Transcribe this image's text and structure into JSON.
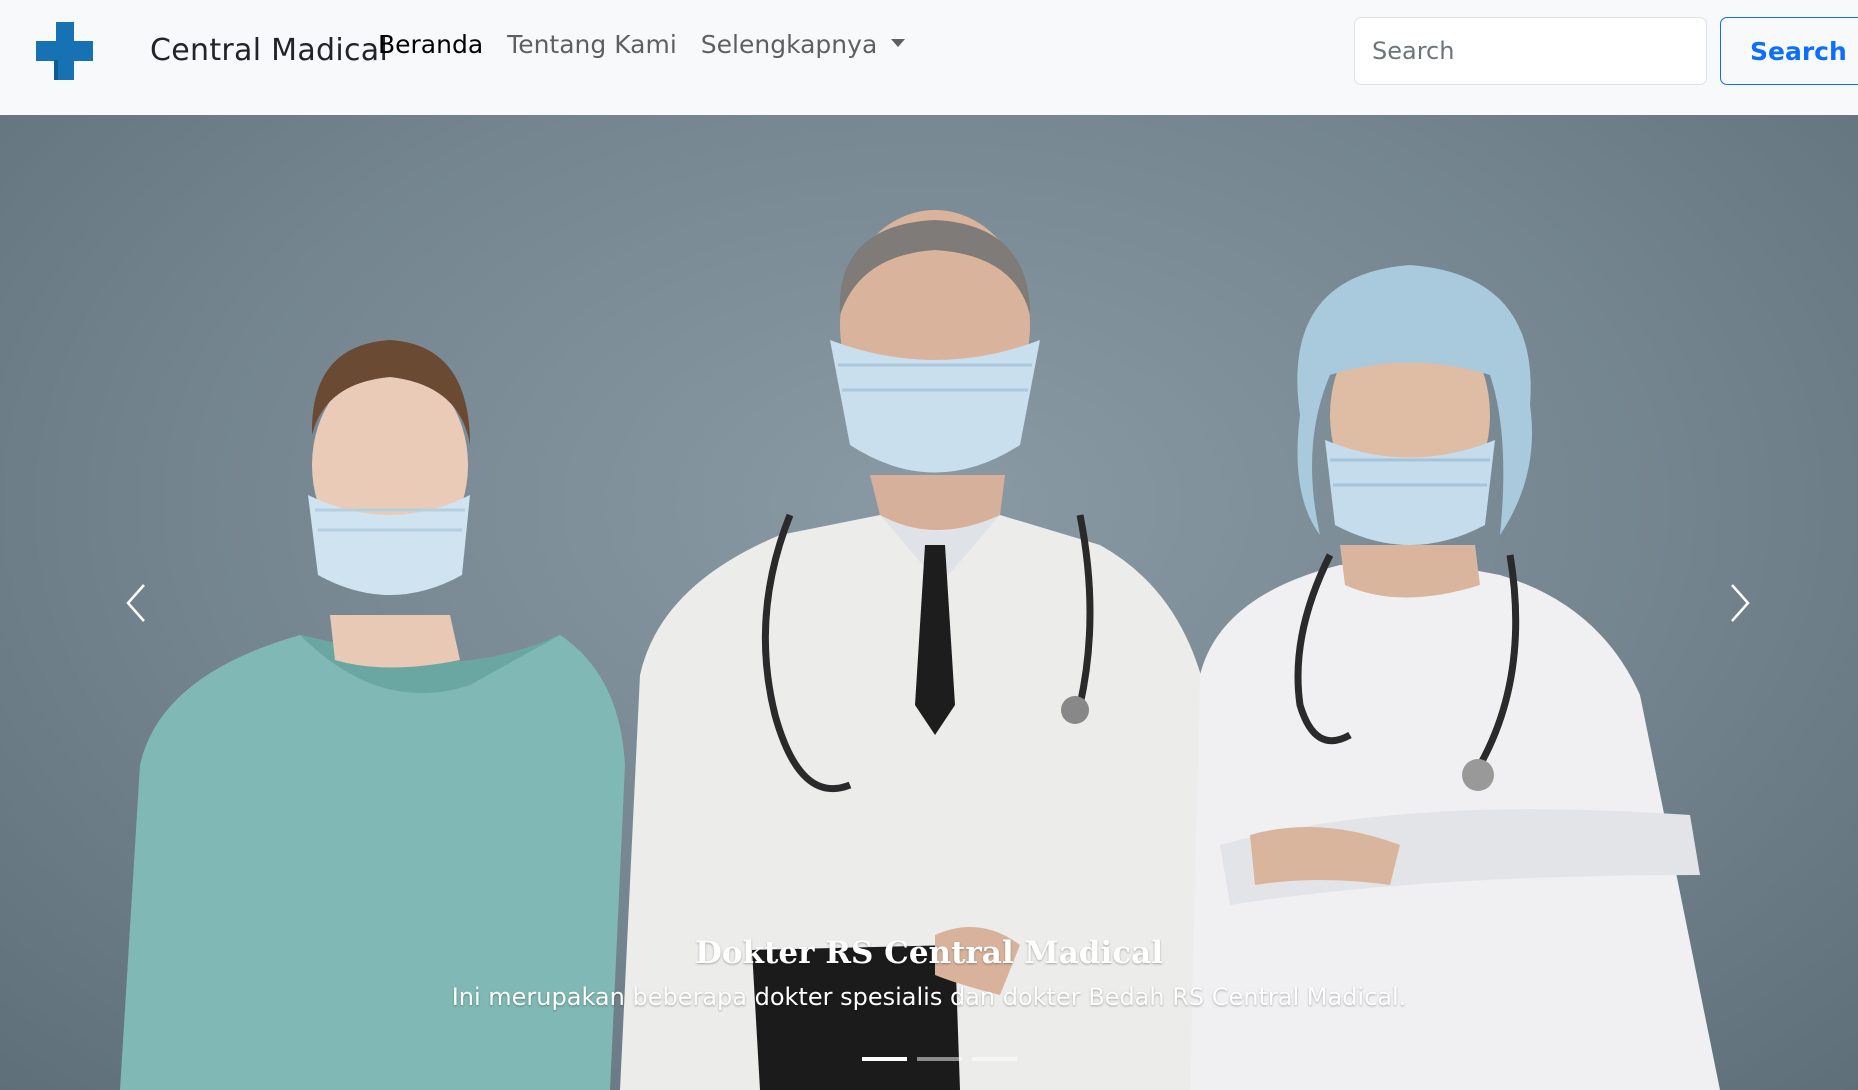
{
  "navbar": {
    "brand_name": "Central Madical",
    "nav_items": [
      {
        "label": "Beranda",
        "active": true
      },
      {
        "label": "Tentang Kami",
        "active": false
      },
      {
        "label": "Selengkapnya",
        "active": false,
        "dropdown": true
      }
    ],
    "search": {
      "placeholder": "Search",
      "button_label": "Search"
    }
  },
  "carousel": {
    "slide_count": 3,
    "active_index": 0,
    "caption": {
      "title": "Dokter RS Central Madical",
      "text": "Ini merupakan beberapa dokter spesialis dan dokter Bedah RS Central Madical."
    },
    "prev_icon": "chevron-left-icon",
    "next_icon": "chevron-right-icon"
  },
  "colors": {
    "brand_blue": "#1672b3",
    "primary": "#0d6efd",
    "navbar_bg": "#f8f9fa",
    "hero_bg": "#748590"
  }
}
